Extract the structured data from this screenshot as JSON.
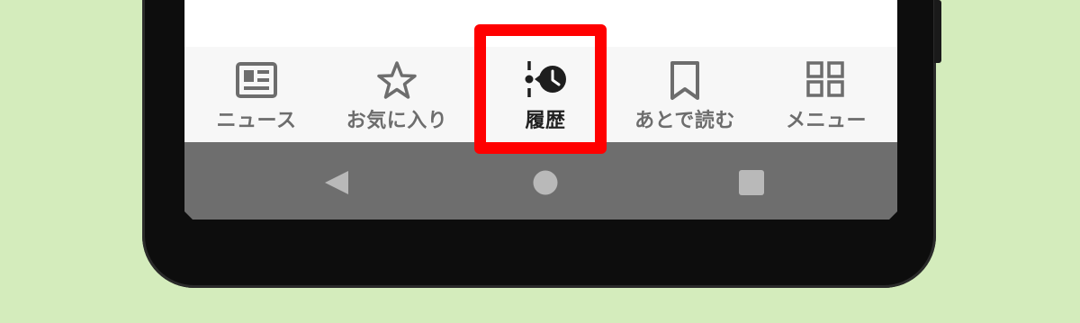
{
  "tabs": [
    {
      "label": "ニュース",
      "icon": "newspaper-icon"
    },
    {
      "label": "お気に入り",
      "icon": "star-icon"
    },
    {
      "label": "履歴",
      "icon": "history-clock-icon",
      "active": true
    },
    {
      "label": "あとで読む",
      "icon": "bookmark-icon"
    },
    {
      "label": "メニュー",
      "icon": "grid-menu-icon"
    }
  ],
  "navbar": {
    "buttons": [
      {
        "icon": "back-triangle-icon"
      },
      {
        "icon": "home-circle-icon"
      },
      {
        "icon": "recents-square-icon"
      }
    ]
  },
  "colors": {
    "background": "#d4ecbc",
    "highlight": "#ff0000",
    "tab_text": "#6d6d6d",
    "active_tab_text": "#222222",
    "navbar": "#6e6e6e"
  }
}
